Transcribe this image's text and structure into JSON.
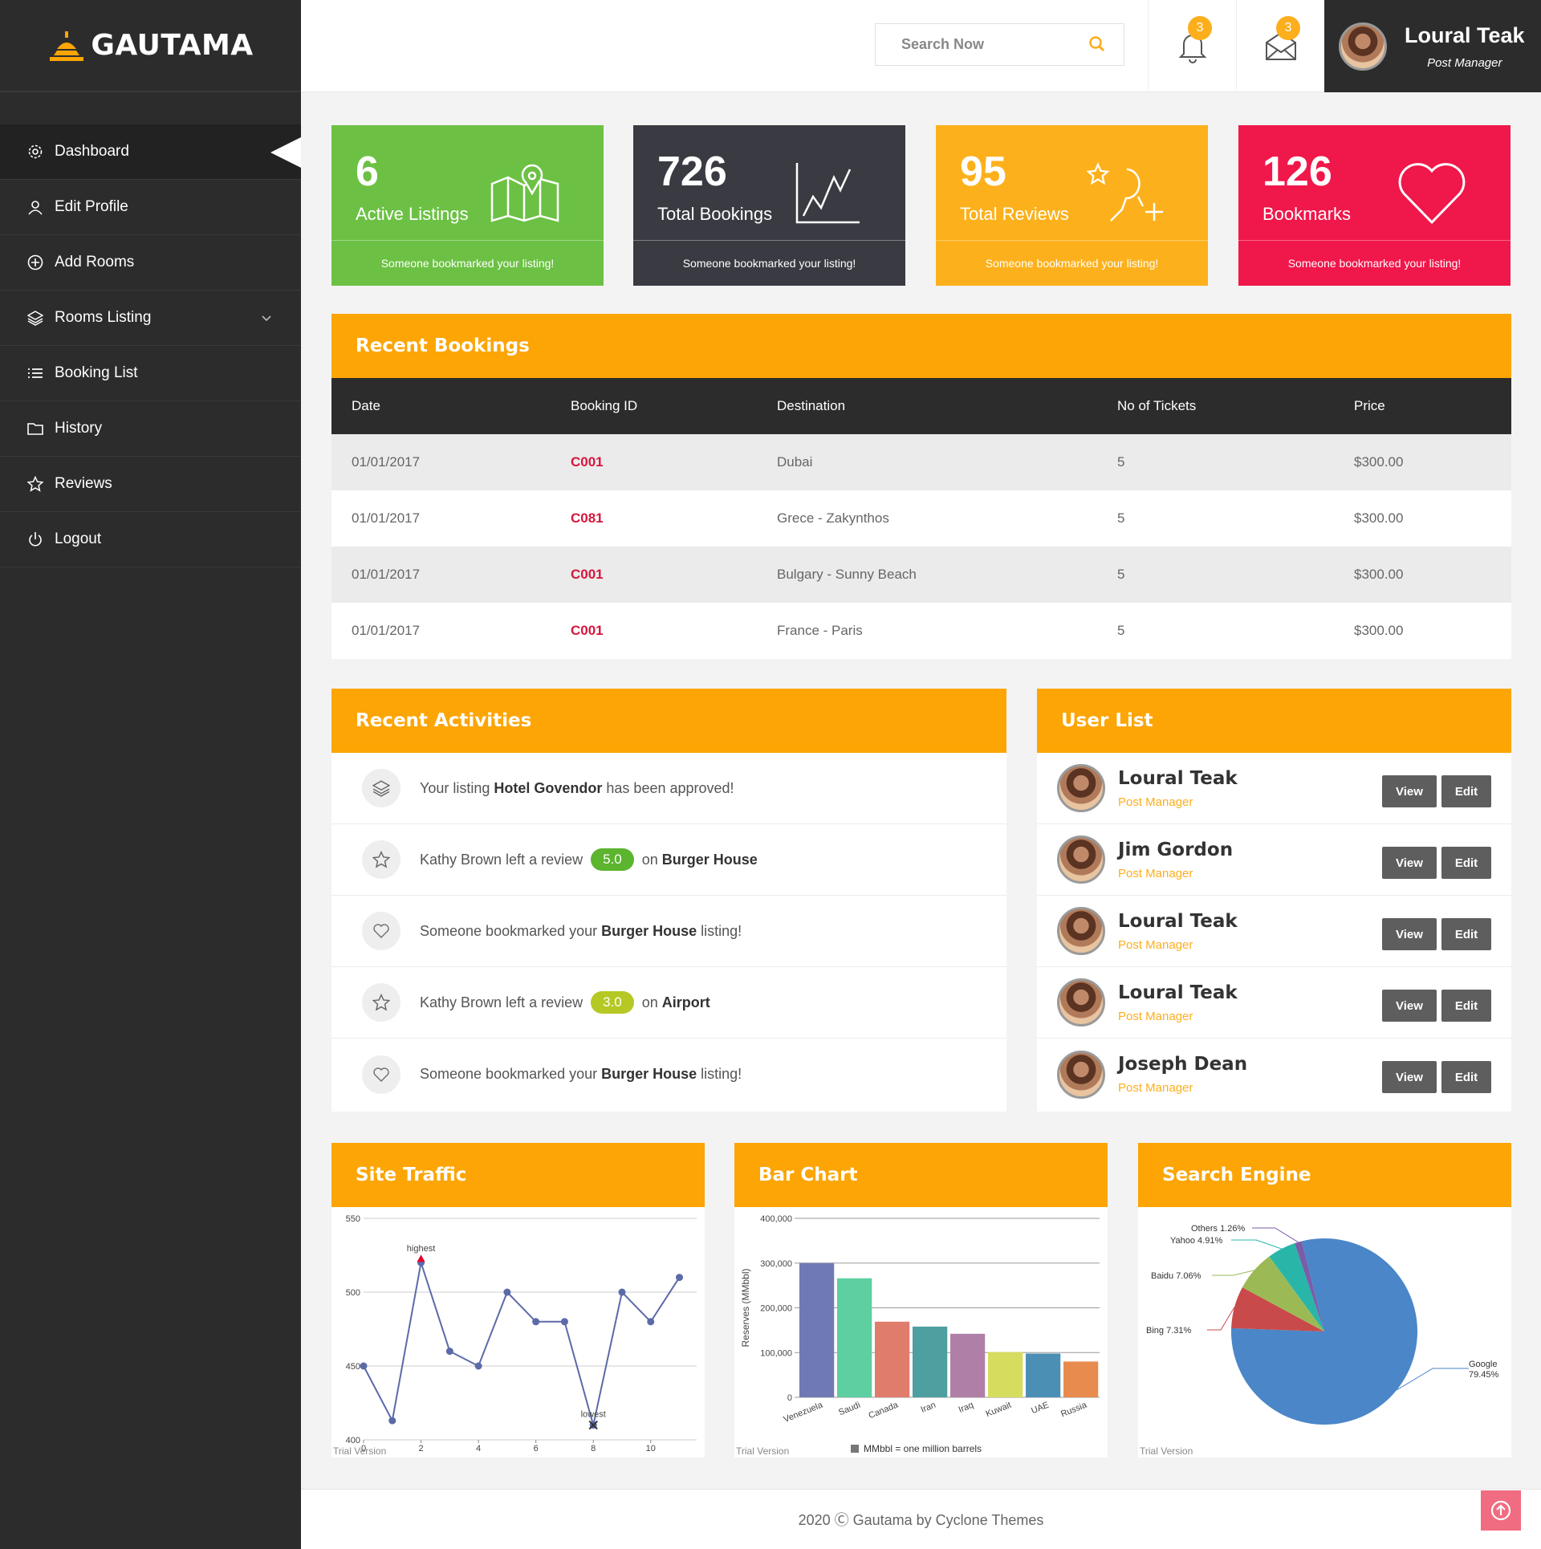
{
  "brand": "GAUTAMA",
  "sidebar": {
    "items": [
      {
        "label": "Dashboard",
        "icon": "gear-icon"
      },
      {
        "label": "Edit Profile",
        "icon": "user-icon"
      },
      {
        "label": "Add Rooms",
        "icon": "plus-circle-icon"
      },
      {
        "label": "Rooms Listing",
        "icon": "layers-icon"
      },
      {
        "label": "Booking List",
        "icon": "list-icon"
      },
      {
        "label": "History",
        "icon": "folder-icon"
      },
      {
        "label": "Reviews",
        "icon": "star-icon"
      },
      {
        "label": "Logout",
        "icon": "power-icon"
      }
    ]
  },
  "header": {
    "search_placeholder": "Search Now",
    "notifications_count": "3",
    "messages_count": "3",
    "user_name": "Loural Teak",
    "user_role": "Post Manager"
  },
  "cards": [
    {
      "value": "6",
      "label": "Active Listings",
      "footer": "Someone bookmarked your listing!",
      "color": "#6cc144",
      "icon": "map-pin-icon"
    },
    {
      "value": "726",
      "label": "Total Bookings",
      "footer": "Someone bookmarked your listing!",
      "color": "#3a3b42",
      "icon": "line-chart-icon"
    },
    {
      "value": "95",
      "label": "Total Reviews",
      "footer": "Someone bookmarked your listing!",
      "color": "#fcb11c",
      "icon": "user-star-icon"
    },
    {
      "value": "126",
      "label": "Bookmarks",
      "footer": "Someone bookmarked your listing!",
      "color": "#f0174a",
      "icon": "heart-icon"
    }
  ],
  "bookings": {
    "title": "Recent Bookings",
    "columns": [
      "Date",
      "Booking ID",
      "Destination",
      "No of Tickets",
      "Price"
    ],
    "rows": [
      [
        "01/01/2017",
        "C001",
        "Dubai",
        "5",
        "$300.00"
      ],
      [
        "01/01/2017",
        "C081",
        "Grece - Zakynthos",
        "5",
        "$300.00"
      ],
      [
        "01/01/2017",
        "C001",
        "Bulgary - Sunny Beach",
        "5",
        "$300.00"
      ],
      [
        "01/01/2017",
        "C001",
        "France - Paris",
        "5",
        "$300.00"
      ]
    ]
  },
  "activities": {
    "title": "Recent Activities",
    "items": [
      {
        "icon": "layers-icon",
        "pre": "Your listing",
        "bold": "Hotel Govendor",
        "post": "has been approved!"
      },
      {
        "icon": "star-icon",
        "pre": "Kathy Brown left a review",
        "rating": "5.0",
        "rating_color": "#5cb42f",
        "mid": "on",
        "bold": "Burger House"
      },
      {
        "icon": "heart-icon",
        "pre": "Someone bookmarked your",
        "bold": "Burger House",
        "post": "listing!"
      },
      {
        "icon": "star-icon",
        "pre": "Kathy Brown left a review",
        "rating": "3.0",
        "rating_color": "#b5c824",
        "mid": "on",
        "bold": "Airport"
      },
      {
        "icon": "heart-icon",
        "pre": "Someone bookmarked your",
        "bold": "Burger House",
        "post": "listing!"
      }
    ]
  },
  "users": {
    "title": "User List",
    "view_label": "View",
    "edit_label": "Edit",
    "items": [
      {
        "name": "Loural Teak",
        "role": "Post Manager"
      },
      {
        "name": "Jim Gordon",
        "role": "Post Manager"
      },
      {
        "name": "Loural Teak",
        "role": "Post Manager"
      },
      {
        "name": "Loural Teak",
        "role": "Post Manager"
      },
      {
        "name": "Joseph Dean",
        "role": "Post Manager"
      }
    ]
  },
  "site_traffic": {
    "title": "Site Traffic",
    "trial": "Trial Version",
    "high_label": "highest",
    "low_label": "lowest"
  },
  "bar_chart": {
    "title": "Bar Chart",
    "trial": "Trial Version",
    "legend": "MMbbl = one million barrels"
  },
  "search_engine": {
    "title": "Search Engine",
    "trial": "Trial Version"
  },
  "chart_data": [
    {
      "type": "line",
      "x": [
        0,
        1,
        2,
        3,
        4,
        5,
        6,
        7,
        8,
        9,
        10,
        11
      ],
      "y": [
        450,
        413,
        520,
        460,
        450,
        500,
        480,
        480,
        410,
        500,
        480,
        510
      ],
      "xticks": [
        "0",
        "2",
        "4",
        "6",
        "8",
        "10"
      ],
      "yticks": [
        "400",
        "450",
        "500",
        "550"
      ],
      "ylim": [
        400,
        550
      ],
      "annotations": [
        {
          "text": "highest",
          "index": 2
        },
        {
          "text": "lowest",
          "index": 8
        }
      ],
      "color": "#5b6aa8"
    },
    {
      "type": "bar",
      "categories": [
        "Venezuela",
        "Saudi",
        "Canada",
        "Iran",
        "Iraq",
        "Kuwait",
        "UAE",
        "Russia"
      ],
      "values": [
        300000,
        266000,
        169000,
        158000,
        142000,
        101000,
        97800,
        80000
      ],
      "colors": [
        "#6f7ab4",
        "#5dcfa0",
        "#e07c6c",
        "#4d9fa0",
        "#b07fa7",
        "#d6dc5e",
        "#4c8fb5",
        "#e88b4f"
      ],
      "ylabel": "Reserves (MMbbl)",
      "yticks": [
        "0",
        "100,000",
        "200,000",
        "300,000",
        "400,000"
      ],
      "ylim": [
        0,
        400000
      ]
    },
    {
      "type": "pie",
      "labels": [
        "Google",
        "Bing",
        "Baidu",
        "Yahoo",
        "Others"
      ],
      "display": [
        "Google 79.45%",
        "Bing 7.31%",
        "Baidu 7.06%",
        "Yahoo 4.91%",
        "Others 1.26%"
      ],
      "values": [
        79.45,
        7.31,
        7.06,
        4.91,
        1.26
      ],
      "colors": [
        "#4a86c8",
        "#c94a4a",
        "#9bba56",
        "#29b6a8",
        "#7a5da8"
      ]
    }
  ],
  "footer": {
    "text": "2020 Ⓒ Gautama by Cyclone Themes"
  }
}
